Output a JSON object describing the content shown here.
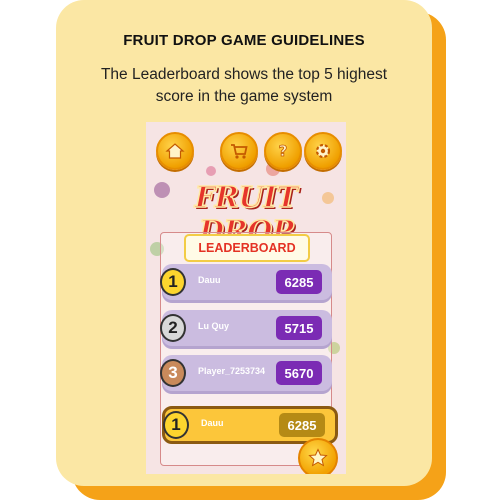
{
  "card": {
    "title": "FRUIT DROP GAME GUIDELINES",
    "subtitle": "The Leaderboard shows the top 5 highest score in the game system"
  },
  "game": {
    "logo": "FRUIT DROP",
    "top_buttons": [
      {
        "icon": "home-icon"
      },
      {
        "icon": "cart-icon"
      },
      {
        "icon": "help-icon"
      },
      {
        "icon": "settings-icon"
      }
    ],
    "leaderboard": {
      "title": "LEADERBOARD",
      "rows": [
        {
          "rank": "1",
          "name": "Dauu",
          "score": "6285"
        },
        {
          "rank": "2",
          "name": "Lu Quy",
          "score": "5715"
        },
        {
          "rank": "3",
          "name": "Player_7253734",
          "score": "5670"
        }
      ],
      "current_player": {
        "rank": "1",
        "name": "Dauu",
        "score": "6285"
      }
    },
    "badge_icon": "star-icon"
  },
  "colors": {
    "card_bg": "#fbe7a4",
    "card_shadow": "#f5a218",
    "score_badge": "#7b2bb4",
    "logo_red": "#e6342b"
  }
}
